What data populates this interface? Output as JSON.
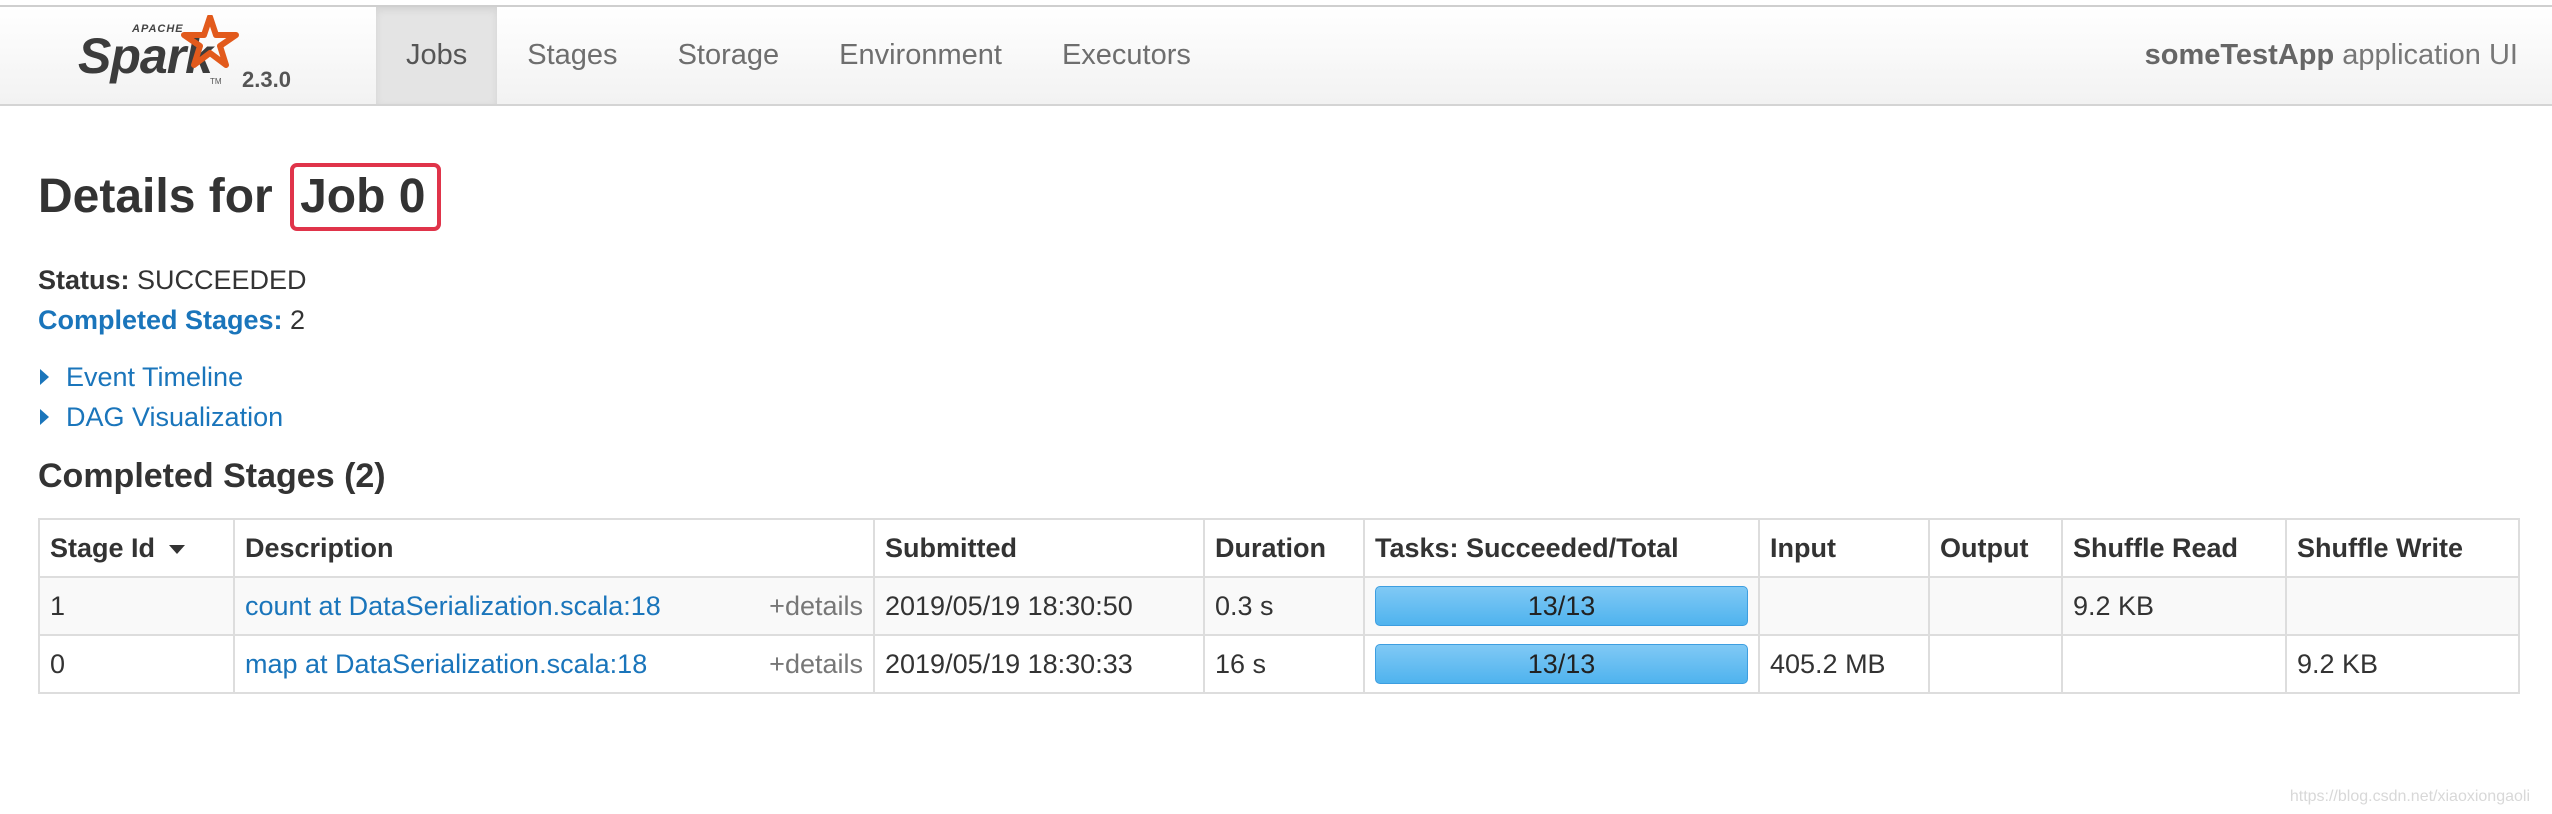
{
  "brand": {
    "apache": "APACHE",
    "name": "Spark",
    "tm": "TM",
    "version": "2.3.0",
    "star_color": "#e25a1c"
  },
  "nav": {
    "items": [
      {
        "label": "Jobs",
        "active": true
      },
      {
        "label": "Stages",
        "active": false
      },
      {
        "label": "Storage",
        "active": false
      },
      {
        "label": "Environment",
        "active": false
      },
      {
        "label": "Executors",
        "active": false
      }
    ],
    "app_name": "someTestApp",
    "app_suffix": " application UI"
  },
  "page": {
    "title_prefix": "Details for ",
    "title_job": "Job 0",
    "status_label": "Status:",
    "status_value": " SUCCEEDED",
    "completed_label": "Completed Stages:",
    "completed_value": " 2",
    "toggles": [
      "Event Timeline",
      "DAG Visualization"
    ],
    "section_title": "Completed Stages (2)",
    "highlight_color": "#e0344a",
    "link_color": "#1a75bb"
  },
  "table": {
    "headers": [
      "Stage Id",
      "Description",
      "Submitted",
      "Duration",
      "Tasks: Succeeded/Total",
      "Input",
      "Output",
      "Shuffle Read",
      "Shuffle Write"
    ],
    "rows": [
      {
        "stage_id": "1",
        "description": "count at DataSerialization.scala:18",
        "details": "+details",
        "submitted": "2019/05/19 18:30:50",
        "duration": "0.3 s",
        "tasks": "13/13",
        "tasks_fraction": 1.0,
        "input": "",
        "output": "",
        "shuffle_read": "9.2 KB",
        "shuffle_write": ""
      },
      {
        "stage_id": "0",
        "description": "map at DataSerialization.scala:18",
        "details": "+details",
        "submitted": "2019/05/19 18:30:33",
        "duration": "16 s",
        "tasks": "13/13",
        "tasks_fraction": 1.0,
        "input": "405.2 MB",
        "output": "",
        "shuffle_read": "",
        "shuffle_write": "9.2 KB"
      }
    ]
  },
  "watermark": "https://blog.csdn.net/xiaoxiongaoli"
}
